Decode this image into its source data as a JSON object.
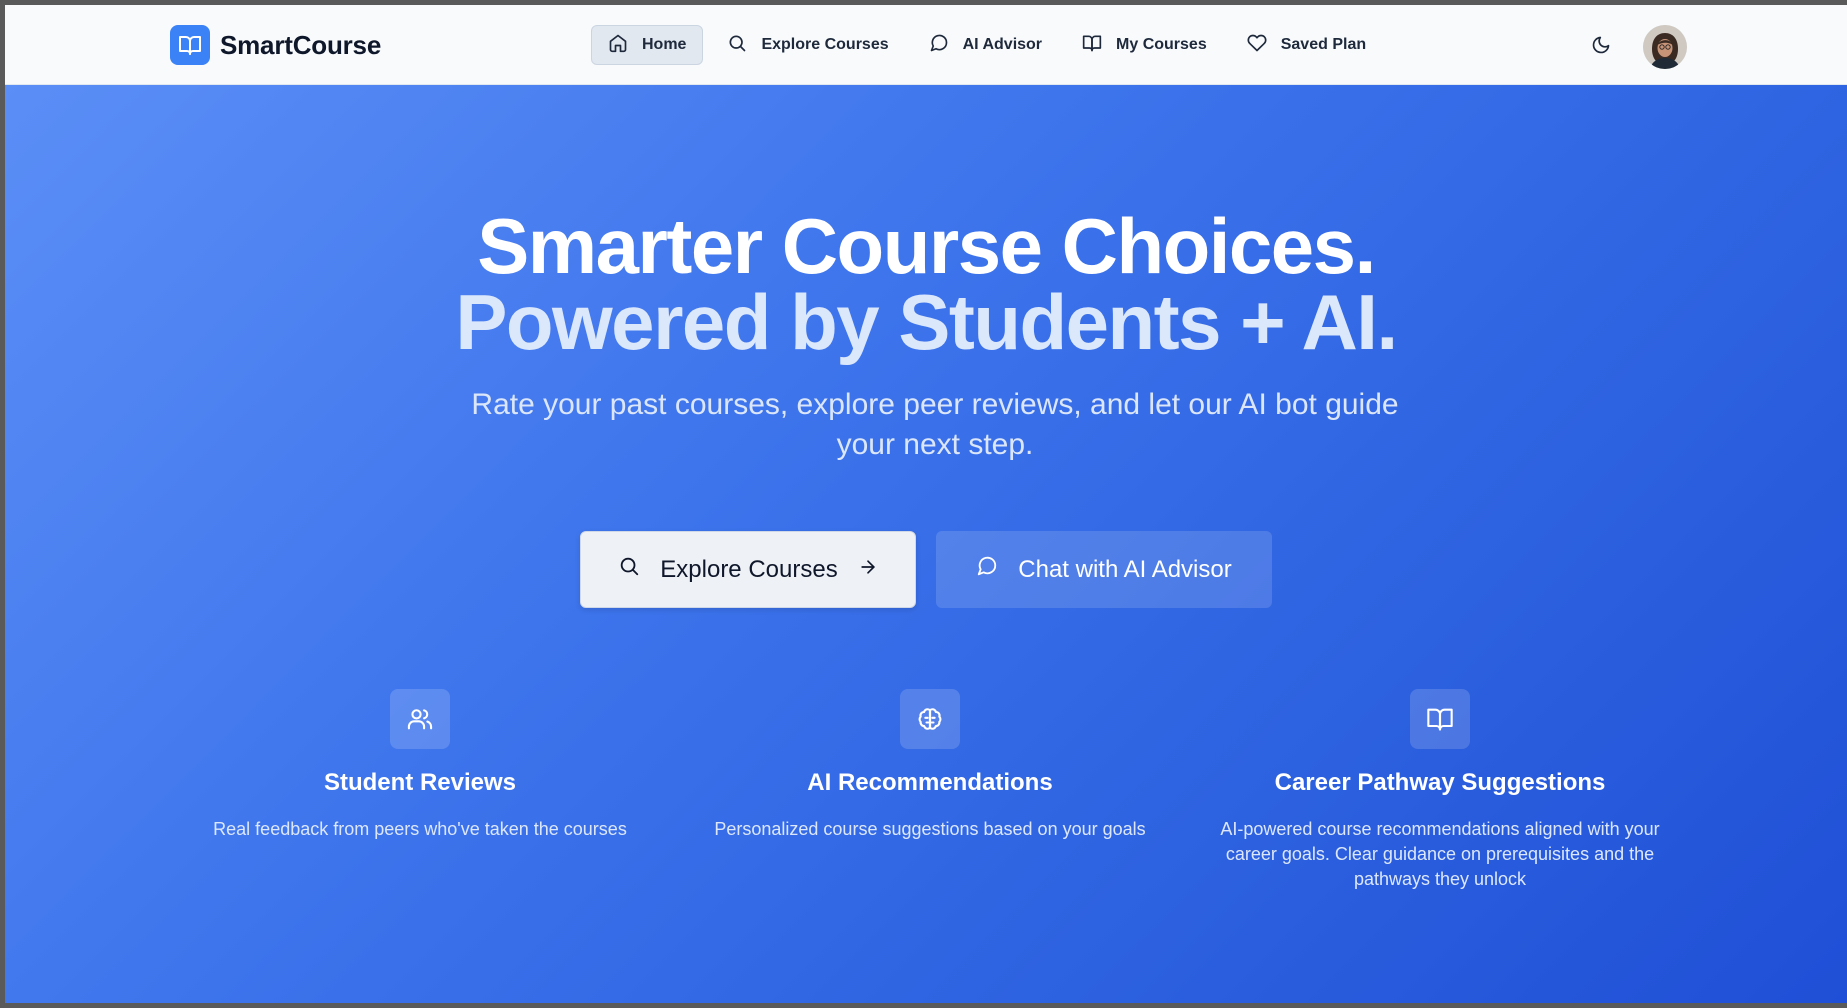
{
  "brand": {
    "name": "SmartCourse",
    "logo_icon": "book-open-icon"
  },
  "nav": {
    "items": [
      {
        "label": "Home",
        "icon": "home-icon",
        "active": true
      },
      {
        "label": "Explore Courses",
        "icon": "search-icon",
        "active": false
      },
      {
        "label": "AI Advisor",
        "icon": "chat-bubble-icon",
        "active": false
      },
      {
        "label": "My Courses",
        "icon": "book-open-icon",
        "active": false
      },
      {
        "label": "Saved Plan",
        "icon": "heart-icon",
        "active": false
      }
    ],
    "theme_toggle_icon": "moon-icon",
    "avatar_icon": "user-avatar"
  },
  "hero": {
    "headline_line1": "Smarter Course Choices.",
    "headline_line2": "Powered by Students + AI.",
    "subtitle": "Rate your past courses, explore peer reviews, and let our AI bot guide your next step.",
    "primary_cta": {
      "label": "Explore Courses",
      "icon": "search-icon",
      "trailing_icon": "arrow-right-icon"
    },
    "secondary_cta": {
      "label": "Chat with AI Advisor",
      "icon": "chat-bubble-icon"
    }
  },
  "features": [
    {
      "icon": "users-icon",
      "title": "Student Reviews",
      "description": "Real feedback from peers who've taken the courses"
    },
    {
      "icon": "brain-icon",
      "title": "AI Recommendations",
      "description": "Personalized course suggestions based on your goals"
    },
    {
      "icon": "book-open-icon",
      "title": "Career Pathway Suggestions",
      "description": "AI-powered course recommendations aligned with your career goals. Clear guidance on prerequisites and the pathways they unlock"
    }
  ],
  "colors": {
    "accent": "#3b82f6",
    "hero_gradient_start": "#5b8ef6",
    "hero_gradient_end": "#1f4fd6",
    "nav_background": "#f8fafc"
  }
}
